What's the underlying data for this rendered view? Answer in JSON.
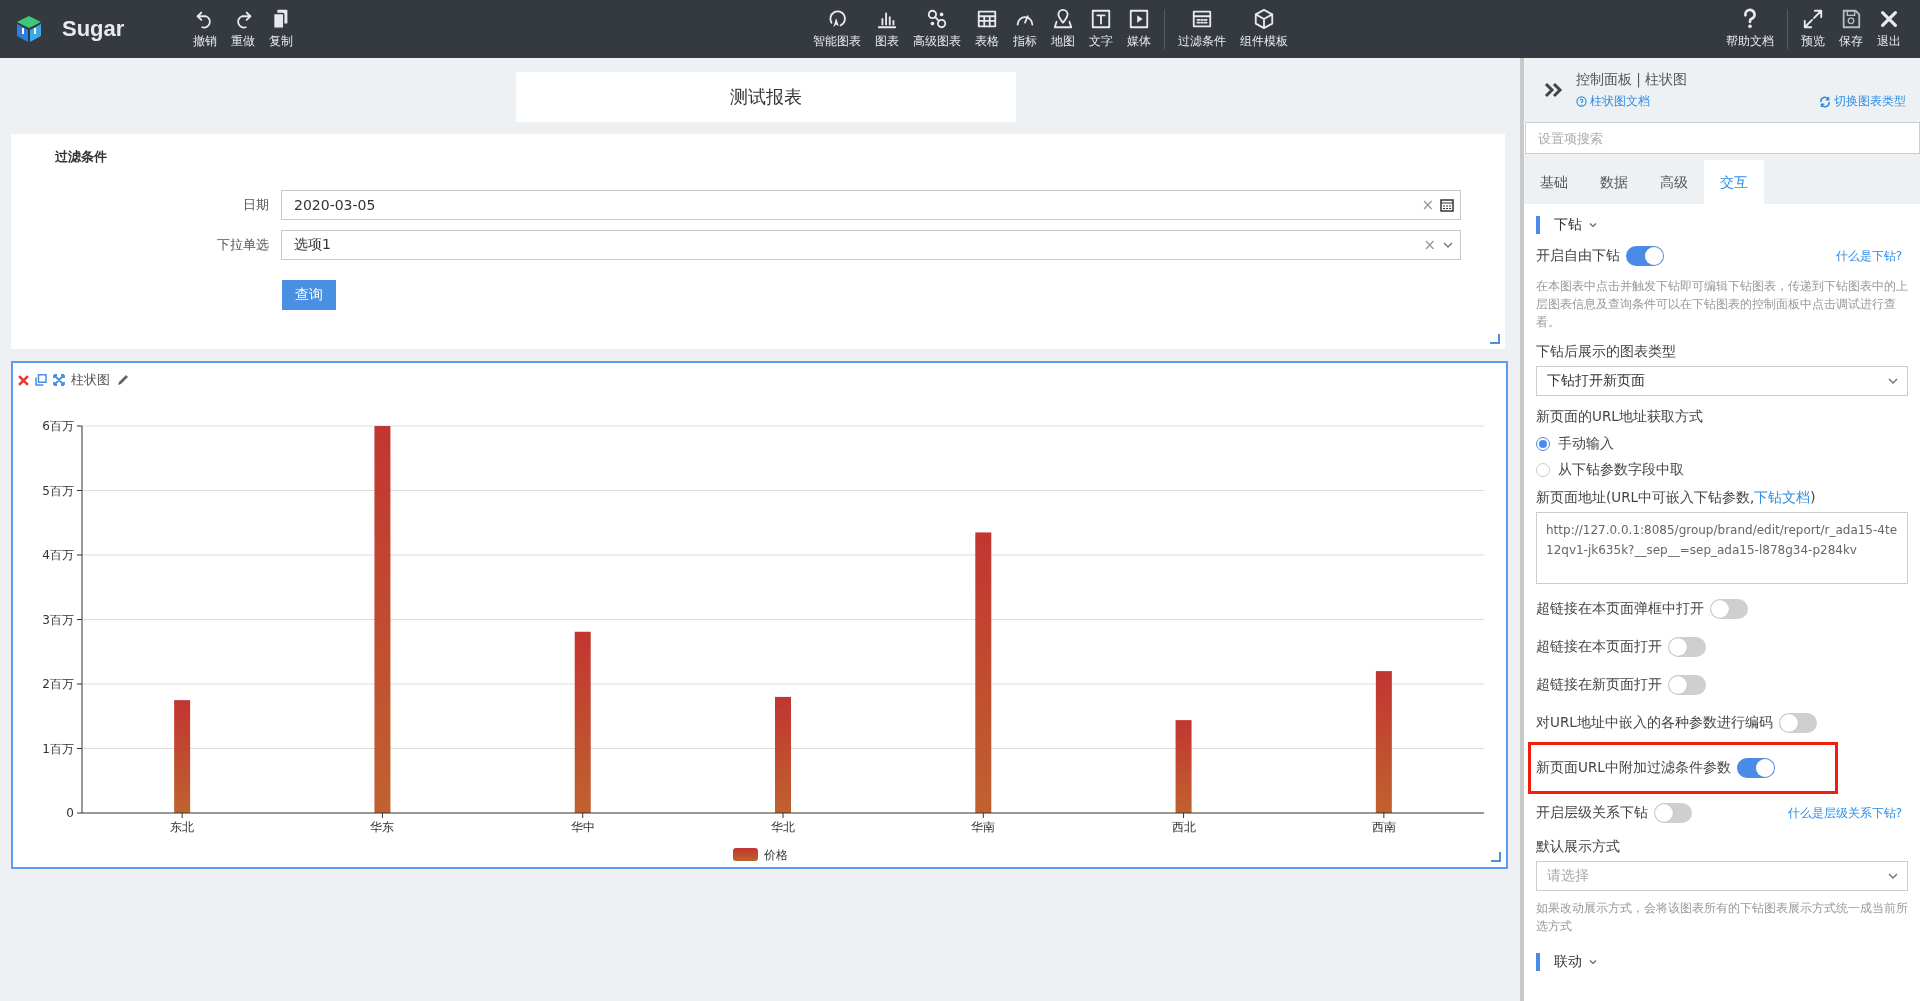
{
  "app": {
    "name": "Sugar"
  },
  "toolbar": {
    "left": [
      {
        "kind": "undo",
        "label": "撤销"
      },
      {
        "kind": "redo",
        "label": "重做"
      },
      {
        "kind": "copy",
        "label": "复制"
      }
    ],
    "center_groups": [
      [
        {
          "kind": "smart",
          "label": "智能图表"
        },
        {
          "kind": "chart",
          "label": "图表"
        },
        {
          "kind": "advanced",
          "label": "高级图表"
        },
        {
          "kind": "table",
          "label": "表格"
        },
        {
          "kind": "metric",
          "label": "指标"
        },
        {
          "kind": "map",
          "label": "地图"
        },
        {
          "kind": "text",
          "label": "文字"
        },
        {
          "kind": "media",
          "label": "媒体"
        }
      ],
      [
        {
          "kind": "filter",
          "label": "过滤条件"
        },
        {
          "kind": "template",
          "label": "组件模板"
        }
      ]
    ],
    "right_groups": [
      [
        {
          "kind": "help",
          "label": "帮助文档"
        }
      ],
      [
        {
          "kind": "preview",
          "label": "预览"
        },
        {
          "kind": "save",
          "label": "保存"
        },
        {
          "kind": "exit",
          "label": "退出"
        }
      ]
    ]
  },
  "report": {
    "title": "测试报表",
    "filter": {
      "title": "过滤条件",
      "fields": [
        {
          "kind": "date",
          "label": "日期",
          "value": "2020-03-05",
          "clear": "×"
        },
        {
          "kind": "select",
          "label": "下拉单选",
          "value": "选项1",
          "clear": "×"
        }
      ],
      "button": "查询"
    },
    "chart_card": {
      "title": "柱状图",
      "chart_data": {
        "type": "bar",
        "categories": [
          "东北",
          "华东",
          "华中",
          "华北",
          "华南",
          "西北",
          "西南"
        ],
        "series": [
          {
            "name": "价格",
            "color": "#c23531",
            "values": [
              1.75,
              6.0,
              2.81,
              1.8,
              4.35,
              1.44,
              2.2
            ]
          }
        ],
        "ylim": [
          0,
          6
        ],
        "grid": true,
        "yticks": [
          {
            "value": 0,
            "label": "0"
          },
          {
            "value": 1,
            "label": "1百万"
          },
          {
            "value": 2,
            "label": "2百万"
          },
          {
            "value": 3,
            "label": "3百万"
          },
          {
            "value": 4,
            "label": "4百万"
          },
          {
            "value": 5,
            "label": "5百万"
          },
          {
            "value": 6,
            "label": "6百万"
          }
        ]
      }
    }
  },
  "panel": {
    "title": "控制面板 | 柱状图",
    "doc_link": "柱状图文档",
    "switch_link": "切换图表类型",
    "search": {
      "placeholder": "设置项搜索"
    },
    "tabs": [
      {
        "label": "基础",
        "selected": false
      },
      {
        "label": "数据",
        "selected": false
      },
      {
        "label": "高级",
        "selected": false
      },
      {
        "label": "交互",
        "selected": true
      }
    ],
    "sections": [
      {
        "title": "下钻",
        "items": [
          {
            "kind": "toggle",
            "label": "开启自由下钻",
            "on": true,
            "help_link": "什么是下钻?"
          },
          {
            "kind": "note",
            "text": "在本图表中点击并触发下钻即可编辑下钻图表，传递到下钻图表中的上层图表信息及查询条件可以在下钻图表的控制面板中点击调试进行查看。"
          },
          {
            "kind": "label",
            "text": "下钻后展示的图表类型"
          },
          {
            "kind": "select",
            "value": "下钻打开新页面"
          },
          {
            "kind": "label",
            "text": "新页面的URL地址获取方式"
          },
          {
            "kind": "radio",
            "options": [
              {
                "label": "手动输入",
                "selected": true
              },
              {
                "label": "从下钻参数字段中取",
                "selected": false
              }
            ]
          },
          {
            "kind": "url",
            "label": "新页面地址(URL中可嵌入下钻参数,",
            "link": "下钻文档",
            "close": ")",
            "value": "http://127.0.0.1:8085/group/brand/edit/report/r_ada15-4te12qv1-jk635k?__sep__=sep_ada15-l878g34-p284kv"
          },
          {
            "kind": "toggle",
            "label": "超链接在本页面弹框中打开",
            "on": false
          },
          {
            "kind": "toggle",
            "label": "超链接在本页面打开",
            "on": false
          },
          {
            "kind": "toggle",
            "label": "超链接在新页面打开",
            "on": false
          },
          {
            "kind": "toggle",
            "label": "对URL地址中嵌入的各种参数进行编码",
            "on": false
          },
          {
            "kind": "toggle",
            "label": "新页面URL中附加过滤条件参数",
            "on": true,
            "highlighted": true
          },
          {
            "kind": "toggle",
            "label": "开启层级关系下钻",
            "on": false,
            "help_link": "什么是层级关系下钻?"
          },
          {
            "kind": "label",
            "text": "默认展示方式"
          },
          {
            "kind": "select",
            "placeholder": "请选择"
          },
          {
            "kind": "note",
            "text": "如果改动展示方式，会将该图表所有的下钻图表展示方式统一成当前所选方式"
          }
        ]
      },
      {
        "title": "联动"
      }
    ]
  }
}
